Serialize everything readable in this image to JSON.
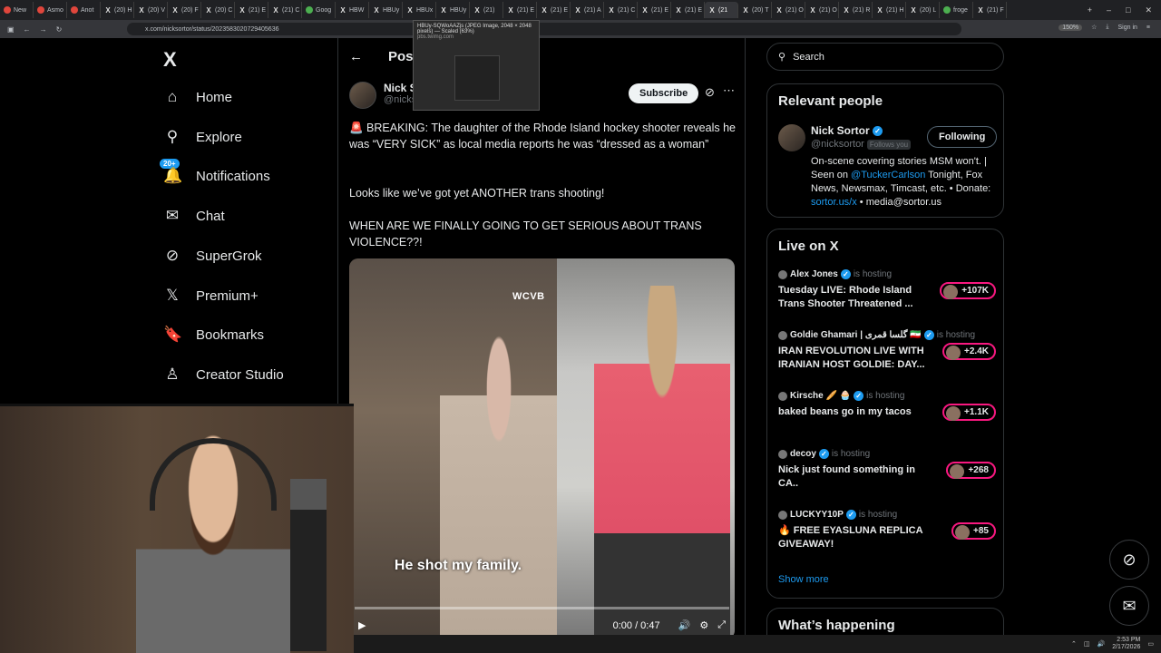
{
  "browser": {
    "tabs": [
      {
        "label": "New",
        "icon": "red"
      },
      {
        "label": "Asmo",
        "icon": "red"
      },
      {
        "label": "Anot",
        "icon": "red"
      },
      {
        "label": "(20) H",
        "icon": "x"
      },
      {
        "label": "(20) V",
        "icon": "x"
      },
      {
        "label": "(20) F",
        "icon": "x"
      },
      {
        "label": "(20) C",
        "icon": "x"
      },
      {
        "label": "(21) E",
        "icon": "x"
      },
      {
        "label": "(21) C",
        "icon": "x"
      },
      {
        "label": "Goog",
        "icon": "grn"
      },
      {
        "label": "HBW",
        "icon": "x"
      },
      {
        "label": "HBUy",
        "icon": "x"
      },
      {
        "label": "HBUx",
        "icon": "x"
      },
      {
        "label": "HBUy",
        "icon": "x"
      },
      {
        "label": "(21)",
        "icon": "x"
      },
      {
        "label": "(21) E",
        "icon": "x"
      },
      {
        "label": "(21) E",
        "icon": "x"
      },
      {
        "label": "(21) A",
        "icon": "x"
      },
      {
        "label": "(21) C",
        "icon": "x"
      },
      {
        "label": "(21) E",
        "icon": "x"
      },
      {
        "label": "(21) E",
        "icon": "x"
      },
      {
        "label": "(21",
        "icon": "x"
      },
      {
        "label": "(20) T",
        "icon": "x"
      },
      {
        "label": "(21) O",
        "icon": "x"
      },
      {
        "label": "(21) O",
        "icon": "x"
      },
      {
        "label": "(21) R",
        "icon": "x"
      },
      {
        "label": "(21) H",
        "icon": "x"
      },
      {
        "label": "(20) L",
        "icon": "x"
      },
      {
        "label": "froge",
        "icon": "grn"
      },
      {
        "label": "(21) F",
        "icon": "x"
      }
    ],
    "active_tab_index": 21,
    "url": "x.com/nicksortor/status/2023583020729405636",
    "zoom": "150%",
    "sign_in": "Sign in",
    "tooltip": {
      "line1": "HBUy-SQWoAAZjs (JPEG Image, 2048 × 2048",
      "line2": "pixels) — Scaled (63%)",
      "line3": "pbs.twimg.com"
    }
  },
  "nav": {
    "logo": "X",
    "items": [
      {
        "label": "Home",
        "icon": "⌂"
      },
      {
        "label": "Explore",
        "icon": "⚲"
      },
      {
        "label": "Notifications",
        "icon": "🔔",
        "badge": "20+"
      },
      {
        "label": "Chat",
        "icon": "✉"
      },
      {
        "label": "SuperGrok",
        "icon": "⊘"
      },
      {
        "label": "Premium+",
        "icon": "𝕏"
      },
      {
        "label": "Bookmarks",
        "icon": "🔖"
      },
      {
        "label": "Creator Studio",
        "icon": "♙"
      }
    ]
  },
  "post": {
    "header": "Post",
    "author_name": "Nick S",
    "author_handle": "@nicks",
    "subscribe": "Subscribe",
    "p1": "🚨 BREAKING: The daughter of the Rhode Island hockey shooter reveals he was “VERY SICK” as local media reports he was “dressed as a woman”",
    "p2": "Looks like we’ve got yet ANOTHER trans shooting!",
    "p3": "WHEN ARE WE FINALLY GOING TO GET SERIOUS ABOUT TRANS VIOLENCE??!",
    "video": {
      "watermark": "WCVB",
      "caption": "He shot my family.",
      "time": "0:00 / 0:47",
      "progress": 0
    }
  },
  "search": {
    "placeholder": "Search"
  },
  "relevant": {
    "title": "Relevant people",
    "name": "Nick Sortor",
    "handle": "@nicksortor",
    "follows_you": "Follows you",
    "follow_label": "Following",
    "bio_pre": "On-scene covering stories MSM won't. | Seen on ",
    "bio_link1": "@TuckerCarlson",
    "bio_mid": " Tonight, Fox News, Newsmax, Timcast, etc. • Donate: ",
    "bio_link2": "sortor.us/x",
    "bio_post": " • media@sortor.us"
  },
  "live": {
    "title": "Live on X",
    "hosting": "is hosting",
    "items": [
      {
        "host": "Alex Jones",
        "title": "Tuesday LIVE: Rhode Island Trans Shooter Threatened ...",
        "count": "+107K"
      },
      {
        "host": "Goldie Ghamari | گلسا قمری 🇮🇷",
        "title": "IRAN REVOLUTION LIVE WITH IRANIAN HOST GOLDIE: DAY...",
        "count": "+2.4K"
      },
      {
        "host": "Kirsche 🥖 🧁",
        "title": "baked beans go in my tacos",
        "count": "+1.1K"
      },
      {
        "host": "decoy",
        "title": "Nick just found something in CA..",
        "count": "+268"
      },
      {
        "host": "LUCKYY10P",
        "title": "🔥 FREE EYASLUNA REPLICA GIVEAWAY!",
        "count": "+85"
      }
    ],
    "show_more": "Show more"
  },
  "happening": {
    "title": "What’s happening"
  },
  "taskbar": {
    "time": "2:53 PM",
    "date": "2/17/2026"
  }
}
